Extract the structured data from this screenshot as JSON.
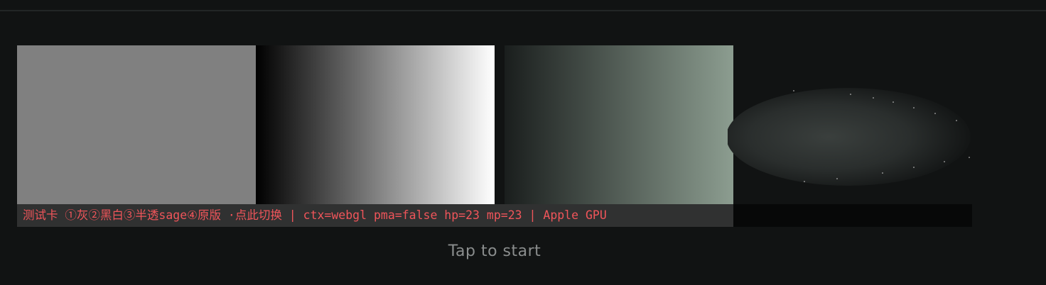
{
  "test_card": {
    "debug_label": "测试卡 ①灰②黑白③半透sage④原版 ·点此切换 | ctx=webgl pma=false hp=23 mp=23 | Apple GPU"
  },
  "prompt": {
    "label": "Tap to start"
  },
  "colors": {
    "background": "#111313",
    "gray_panel": "#808080",
    "sage": "#8c9d90",
    "debug_text": "#f0555a"
  }
}
